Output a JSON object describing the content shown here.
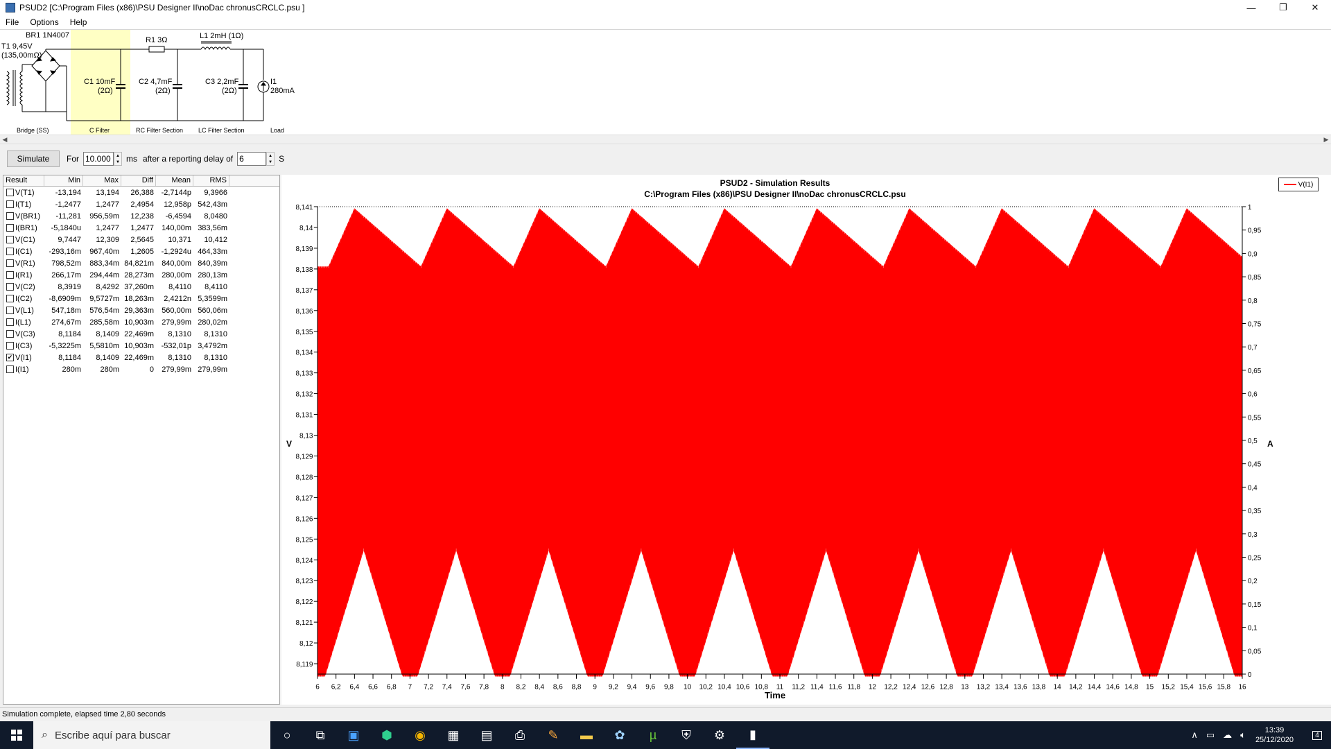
{
  "window": {
    "title": "PSUD2  [C:\\Program Files (x86)\\PSU Designer II\\noDac chronusCRCLC.psu ]",
    "minimize": "—",
    "maximize": "❐",
    "close": "✕"
  },
  "menu": [
    "File",
    "Options",
    "Help"
  ],
  "circuit": {
    "t1_label": "T1 9,45V",
    "t1_sub": "(135,00mΩ)",
    "br1_label": "BR1 1N4007",
    "c1_label": "C1 10mF",
    "c1_esr": "(2Ω)",
    "r1_label": "R1 3Ω",
    "c2_label": "C2 4,7mF",
    "c2_esr": "(2Ω)",
    "l1_label": "L1 2mH (1Ω)",
    "c3_label": "C3 2,2mF",
    "c3_esr": "(2Ω)",
    "i1_label": "I1",
    "i1_value": "280mA",
    "sections": [
      "Bridge (SS)",
      "C Filter",
      "RC Filter Section",
      "LC Filter Section",
      "Load"
    ]
  },
  "sim": {
    "button": "Simulate",
    "for_label": "For",
    "duration": "10.000",
    "ms_label": "ms",
    "delay_label": "after a reporting delay of",
    "delay": "6",
    "s_label": "S"
  },
  "results": {
    "headers": [
      "Result",
      "Min",
      "Max",
      "Diff",
      "Mean",
      "RMS"
    ],
    "rows": [
      {
        "checked": false,
        "name": "V(T1)",
        "min": "-13,194",
        "max": "13,194",
        "diff": "26,388",
        "mean": "-2,7144p",
        "rms": "9,3966"
      },
      {
        "checked": false,
        "name": "I(T1)",
        "min": "-1,2477",
        "max": "1,2477",
        "diff": "2,4954",
        "mean": "12,958p",
        "rms": "542,43m"
      },
      {
        "checked": false,
        "name": "V(BR1)",
        "min": "-11,281",
        "max": "956,59m",
        "diff": "12,238",
        "mean": "-6,4594",
        "rms": "8,0480"
      },
      {
        "checked": false,
        "name": "I(BR1)",
        "min": "-5,1840u",
        "max": "1,2477",
        "diff": "1,2477",
        "mean": "140,00m",
        "rms": "383,56m"
      },
      {
        "checked": false,
        "name": "V(C1)",
        "min": "9,7447",
        "max": "12,309",
        "diff": "2,5645",
        "mean": "10,371",
        "rms": "10,412"
      },
      {
        "checked": false,
        "name": "I(C1)",
        "min": "-293,16m",
        "max": "967,40m",
        "diff": "1,2605",
        "mean": "-1,2924u",
        "rms": "464,33m"
      },
      {
        "checked": false,
        "name": "V(R1)",
        "min": "798,52m",
        "max": "883,34m",
        "diff": "84,821m",
        "mean": "840,00m",
        "rms": "840,39m"
      },
      {
        "checked": false,
        "name": "I(R1)",
        "min": "266,17m",
        "max": "294,44m",
        "diff": "28,273m",
        "mean": "280,00m",
        "rms": "280,13m"
      },
      {
        "checked": false,
        "name": "V(C2)",
        "min": "8,3919",
        "max": "8,4292",
        "diff": "37,260m",
        "mean": "8,4110",
        "rms": "8,4110"
      },
      {
        "checked": false,
        "name": "I(C2)",
        "min": "-8,6909m",
        "max": "9,5727m",
        "diff": "18,263m",
        "mean": "2,4212n",
        "rms": "5,3599m"
      },
      {
        "checked": false,
        "name": "V(L1)",
        "min": "547,18m",
        "max": "576,54m",
        "diff": "29,363m",
        "mean": "560,00m",
        "rms": "560,06m"
      },
      {
        "checked": false,
        "name": "I(L1)",
        "min": "274,67m",
        "max": "285,58m",
        "diff": "10,903m",
        "mean": "279,99m",
        "rms": "280,02m"
      },
      {
        "checked": false,
        "name": "V(C3)",
        "min": "8,1184",
        "max": "8,1409",
        "diff": "22,469m",
        "mean": "8,1310",
        "rms": "8,1310"
      },
      {
        "checked": false,
        "name": "I(C3)",
        "min": "-5,3225m",
        "max": "5,5810m",
        "diff": "10,903m",
        "mean": "-532,01p",
        "rms": "3,4792m"
      },
      {
        "checked": true,
        "name": "V(I1)",
        "min": "8,1184",
        "max": "8,1409",
        "diff": "22,469m",
        "mean": "8,1310",
        "rms": "8,1310"
      },
      {
        "checked": false,
        "name": "I(I1)",
        "min": "280m",
        "max": "280m",
        "diff": "0",
        "mean": "279,99m",
        "rms": "279,99m"
      }
    ]
  },
  "chart_data": {
    "type": "line",
    "title": "PSUD2 - Simulation Results",
    "subtitle": "C:\\Program Files (x86)\\PSU Designer II\\noDac chronusCRCLC.psu",
    "xlabel": "Time",
    "ylabel": "V",
    "y2label": "A",
    "xlim": [
      6,
      16
    ],
    "ylim": [
      8.1185,
      8.141
    ],
    "y2lim": [
      0,
      1
    ],
    "x_ticks": [
      "6",
      "6,2",
      "6,4",
      "6,6",
      "6,8",
      "7",
      "7,2",
      "7,4",
      "7,6",
      "7,8",
      "8",
      "8,2",
      "8,4",
      "8,6",
      "8,8",
      "9",
      "9,2",
      "9,4",
      "9,6",
      "9,8",
      "10",
      "10,2",
      "10,4",
      "10,6",
      "10,8",
      "11",
      "11,2",
      "11,4",
      "11,6",
      "11,8",
      "12",
      "12,2",
      "12,4",
      "12,6",
      "12,8",
      "13",
      "13,2",
      "13,4",
      "13,6",
      "13,8",
      "14",
      "14,2",
      "14,4",
      "14,6",
      "14,8",
      "15",
      "15,2",
      "15,4",
      "15,6",
      "15,8",
      "16"
    ],
    "y_ticks": [
      "8,141",
      "8,14",
      "8,139",
      "8,138",
      "8,137",
      "8,136",
      "8,135",
      "8,134",
      "8,133",
      "8,132",
      "8,131",
      "8,13",
      "8,129",
      "8,128",
      "8,127",
      "8,126",
      "8,125",
      "8,124",
      "8,123",
      "8,122",
      "8,121",
      "8,12",
      "8,119"
    ],
    "y2_ticks": [
      "1",
      "0,95",
      "0,9",
      "0,85",
      "0,8",
      "0,75",
      "0,7",
      "0,65",
      "0,6",
      "0,55",
      "0,5",
      "0,45",
      "0,4",
      "0,35",
      "0,3",
      "0,25",
      "0,2",
      "0,15",
      "0,1",
      "0,05",
      "0"
    ],
    "series": [
      {
        "name": "V(I1)",
        "color": "#ff0000",
        "upper_envelope_peaks_x": [
          6.4,
          7.4,
          8.4,
          9.4,
          10.4,
          11.4,
          12.4,
          13.4,
          14.4,
          15.4
        ],
        "upper_max": 8.1409,
        "upper_min": 8.1381,
        "lower_envelope_peaks_x": [
          6.5,
          7.5,
          8.5,
          9.5,
          10.5,
          11.5,
          12.5,
          13.5,
          14.5,
          15.5
        ],
        "lower_peak": 8.1245,
        "lower_min": 8.1184
      }
    ],
    "legend": "top-right",
    "grid": false
  },
  "status": "Simulation complete, elapsed time 2,80 seconds",
  "taskbar": {
    "search_placeholder": "Escribe aquí para buscar",
    "time": "13:39",
    "date": "25/12/2020",
    "notifications": "4"
  }
}
